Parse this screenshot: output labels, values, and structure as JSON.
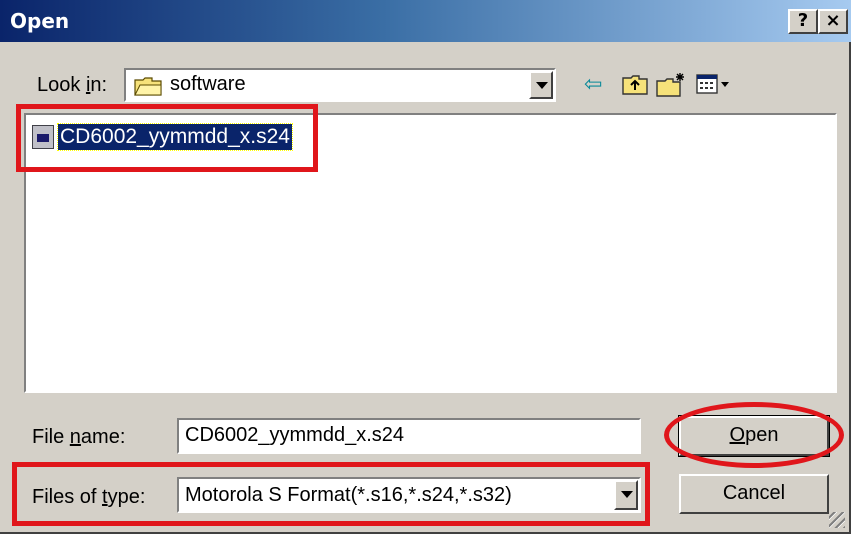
{
  "window": {
    "title": "Open",
    "help_label": "?",
    "close_label": "×"
  },
  "look_in": {
    "label_pre": "Look ",
    "label_key": "i",
    "label_post": "n:",
    "value": "software"
  },
  "files": [
    {
      "name": "CD6002_yymmdd_x.s24"
    }
  ],
  "file_name": {
    "label_pre": "File ",
    "label_key": "n",
    "label_post": "ame:",
    "value": "CD6002_yymmdd_x.s24"
  },
  "file_type": {
    "label_pre": "Files of ",
    "label_key": "t",
    "label_post": "ype:",
    "value": "Motorola S Format(*.s16,*.s24,*.s32)"
  },
  "buttons": {
    "open_key": "O",
    "open_rest": "pen",
    "cancel": "Cancel"
  },
  "colors": {
    "annotation": "#e0161b",
    "title_start": "#0a246a",
    "title_end": "#a6caf0",
    "selection": "#0a246a"
  }
}
